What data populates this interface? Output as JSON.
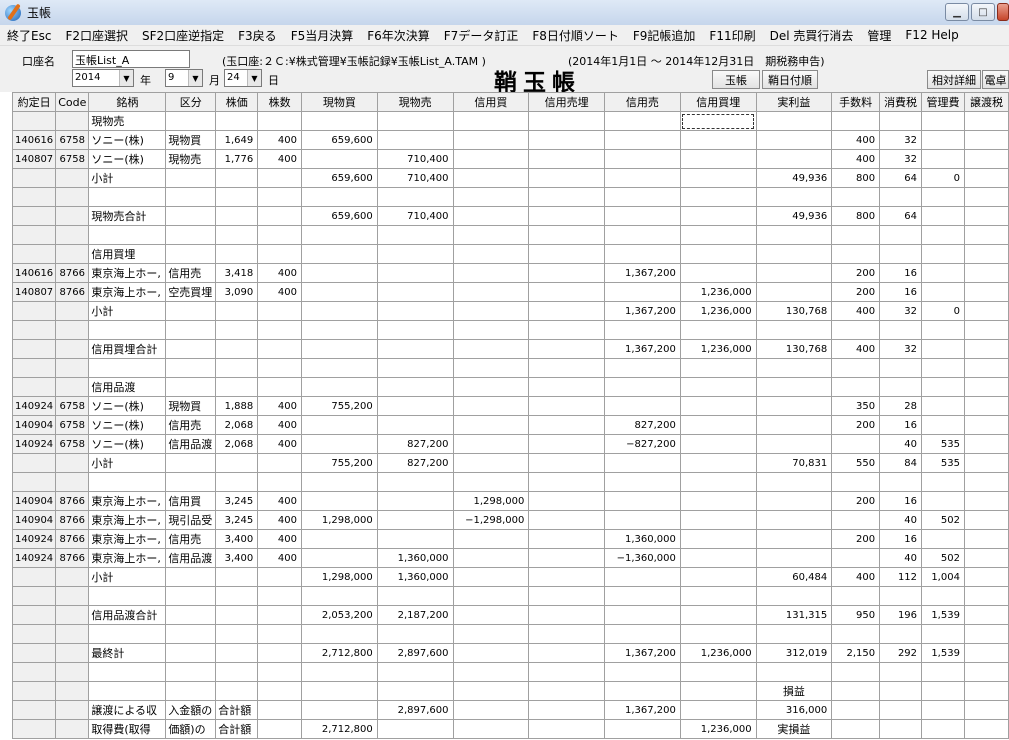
{
  "window": {
    "title": "玉帳"
  },
  "menu": [
    "終了Esc",
    "F2口座選択",
    "SF2口座逆指定",
    "F3戻る",
    "F5当月決算",
    "F6年次決算",
    "F7データ訂正",
    "F8日付順ソート",
    "F9記帳追加",
    "F11印刷",
    "Del 売買行消去",
    "管理",
    "F12 Help"
  ],
  "toolbar": {
    "account_label": "口座名",
    "account_value": "玉帳List_A",
    "file_path": "(玉口座:２Ｃ:¥株式管理¥玉帳記録¥玉帳List_A.TAM )",
    "period": "(2014年1月1日 〜 2014年12月31日　期税務申告)",
    "year": "2014",
    "year_label": "年",
    "month": "9",
    "month_label": "月",
    "day": "24",
    "day_label": "日",
    "page_title": "鞘玉帳",
    "btn_tamacho": "玉帳",
    "btn_saya_date": "鞘日付順",
    "btn_relative": "相対詳細",
    "btn_denshi": "電卓"
  },
  "columns": [
    "約定日",
    "Code",
    "銘柄",
    "区分",
    "株価",
    "株数",
    "現物買",
    "現物売",
    "信用買",
    "信用売埋",
    "信用売",
    "信用買埋",
    "実利益",
    "手数料",
    "消費税",
    "管理費",
    "譲渡税"
  ],
  "rows": [
    [
      "",
      "",
      "現物売",
      "",
      "",
      "",
      "",
      "",
      "",
      "",
      "",
      "",
      "",
      "",
      "",
      "",
      ""
    ],
    [
      "140616",
      "6758",
      "ソニー(株)",
      "現物買",
      "1,649",
      "400",
      "659,600",
      "",
      "",
      "",
      "",
      "",
      "",
      "400",
      "32",
      "",
      ""
    ],
    [
      "140807",
      "6758",
      "ソニー(株)",
      "現物売",
      "1,776",
      "400",
      "",
      "710,400",
      "",
      "",
      "",
      "",
      "",
      "400",
      "32",
      "",
      ""
    ],
    [
      "",
      "",
      "小計",
      "",
      "",
      "",
      "659,600",
      "710,400",
      "",
      "",
      "",
      "",
      "49,936",
      "800",
      "64",
      "0",
      ""
    ],
    [
      "",
      "",
      "",
      "",
      "",
      "",
      "",
      "",
      "",
      "",
      "",
      "",
      "",
      "",
      "",
      "",
      ""
    ],
    [
      "",
      "",
      "現物売合計",
      "",
      "",
      "",
      "659,600",
      "710,400",
      "",
      "",
      "",
      "",
      "49,936",
      "800",
      "64",
      "",
      ""
    ],
    [
      "",
      "",
      "",
      "",
      "",
      "",
      "",
      "",
      "",
      "",
      "",
      "",
      "",
      "",
      "",
      "",
      ""
    ],
    [
      "",
      "",
      "信用買埋",
      "",
      "",
      "",
      "",
      "",
      "",
      "",
      "",
      "",
      "",
      "",
      "",
      "",
      ""
    ],
    [
      "140616",
      "8766",
      "東京海上ホー,",
      "信用売",
      "3,418",
      "400",
      "",
      "",
      "",
      "",
      "1,367,200",
      "",
      "",
      "200",
      "16",
      "",
      ""
    ],
    [
      "140807",
      "8766",
      "東京海上ホー,",
      "空売買埋",
      "3,090",
      "400",
      "",
      "",
      "",
      "",
      "",
      "1,236,000",
      "",
      "200",
      "16",
      "",
      ""
    ],
    [
      "",
      "",
      "小計",
      "",
      "",
      "",
      "",
      "",
      "",
      "",
      "1,367,200",
      "1,236,000",
      "130,768",
      "400",
      "32",
      "0",
      ""
    ],
    [
      "",
      "",
      "",
      "",
      "",
      "",
      "",
      "",
      "",
      "",
      "",
      "",
      "",
      "",
      "",
      "",
      ""
    ],
    [
      "",
      "",
      "信用買埋合計",
      "",
      "",
      "",
      "",
      "",
      "",
      "",
      "1,367,200",
      "1,236,000",
      "130,768",
      "400",
      "32",
      "",
      ""
    ],
    [
      "",
      "",
      "",
      "",
      "",
      "",
      "",
      "",
      "",
      "",
      "",
      "",
      "",
      "",
      "",
      "",
      ""
    ],
    [
      "",
      "",
      "信用品渡",
      "",
      "",
      "",
      "",
      "",
      "",
      "",
      "",
      "",
      "",
      "",
      "",
      "",
      ""
    ],
    [
      "140924",
      "6758",
      "ソニー(株)",
      "現物買",
      "1,888",
      "400",
      "755,200",
      "",
      "",
      "",
      "",
      "",
      "",
      "350",
      "28",
      "",
      ""
    ],
    [
      "140904",
      "6758",
      "ソニー(株)",
      "信用売",
      "2,068",
      "400",
      "",
      "",
      "",
      "",
      "827,200",
      "",
      "",
      "200",
      "16",
      "",
      ""
    ],
    [
      "140924",
      "6758",
      "ソニー(株)",
      "信用品渡",
      "2,068",
      "400",
      "",
      "827,200",
      "",
      "",
      "−827,200",
      "",
      "",
      "",
      "40",
      "535",
      ""
    ],
    [
      "",
      "",
      "小計",
      "",
      "",
      "",
      "755,200",
      "827,200",
      "",
      "",
      "",
      "",
      "70,831",
      "550",
      "84",
      "535",
      ""
    ],
    [
      "",
      "",
      "",
      "",
      "",
      "",
      "",
      "",
      "",
      "",
      "",
      "",
      "",
      "",
      "",
      "",
      ""
    ],
    [
      "140904",
      "8766",
      "東京海上ホー,",
      "信用買",
      "3,245",
      "400",
      "",
      "",
      "1,298,000",
      "",
      "",
      "",
      "",
      "200",
      "16",
      "",
      ""
    ],
    [
      "140904",
      "8766",
      "東京海上ホー,",
      "現引品受",
      "3,245",
      "400",
      "1,298,000",
      "",
      "−1,298,000",
      "",
      "",
      "",
      "",
      "",
      "40",
      "502",
      ""
    ],
    [
      "140924",
      "8766",
      "東京海上ホー,",
      "信用売",
      "3,400",
      "400",
      "",
      "",
      "",
      "",
      "1,360,000",
      "",
      "",
      "200",
      "16",
      "",
      ""
    ],
    [
      "140924",
      "8766",
      "東京海上ホー,",
      "信用品渡",
      "3,400",
      "400",
      "",
      "1,360,000",
      "",
      "",
      "−1,360,000",
      "",
      "",
      "",
      "40",
      "502",
      ""
    ],
    [
      "",
      "",
      "小計",
      "",
      "",
      "",
      "1,298,000",
      "1,360,000",
      "",
      "",
      "",
      "",
      "60,484",
      "400",
      "112",
      "1,004",
      ""
    ],
    [
      "",
      "",
      "",
      "",
      "",
      "",
      "",
      "",
      "",
      "",
      "",
      "",
      "",
      "",
      "",
      "",
      ""
    ],
    [
      "",
      "",
      "信用品渡合計",
      "",
      "",
      "",
      "2,053,200",
      "2,187,200",
      "",
      "",
      "",
      "",
      "131,315",
      "950",
      "196",
      "1,539",
      ""
    ],
    [
      "",
      "",
      "",
      "",
      "",
      "",
      "",
      "",
      "",
      "",
      "",
      "",
      "",
      "",
      "",
      "",
      ""
    ],
    [
      "",
      "",
      "最終計",
      "",
      "",
      "",
      "2,712,800",
      "2,897,600",
      "",
      "",
      "1,367,200",
      "1,236,000",
      "312,019",
      "2,150",
      "292",
      "1,539",
      ""
    ],
    [
      "",
      "",
      "",
      "",
      "",
      "",
      "",
      "",
      "",
      "",
      "",
      "",
      "",
      "",
      "",
      "",
      ""
    ],
    [
      "",
      "",
      "",
      "",
      "",
      "",
      "",
      "",
      "",
      "",
      "",
      "",
      "損益",
      "",
      "",
      "",
      ""
    ],
    [
      "",
      "",
      "譲渡による収",
      "入金額の",
      "合計額",
      "",
      "",
      "2,897,600",
      "",
      "",
      "1,367,200",
      "",
      "316,000",
      "",
      "",
      "",
      ""
    ],
    [
      "",
      "",
      "取得費(取得",
      "価額)の",
      "合計額",
      "",
      "2,712,800",
      "",
      "",
      "",
      "",
      "1,236,000",
      "実損益",
      "",
      "",
      "",
      ""
    ]
  ]
}
